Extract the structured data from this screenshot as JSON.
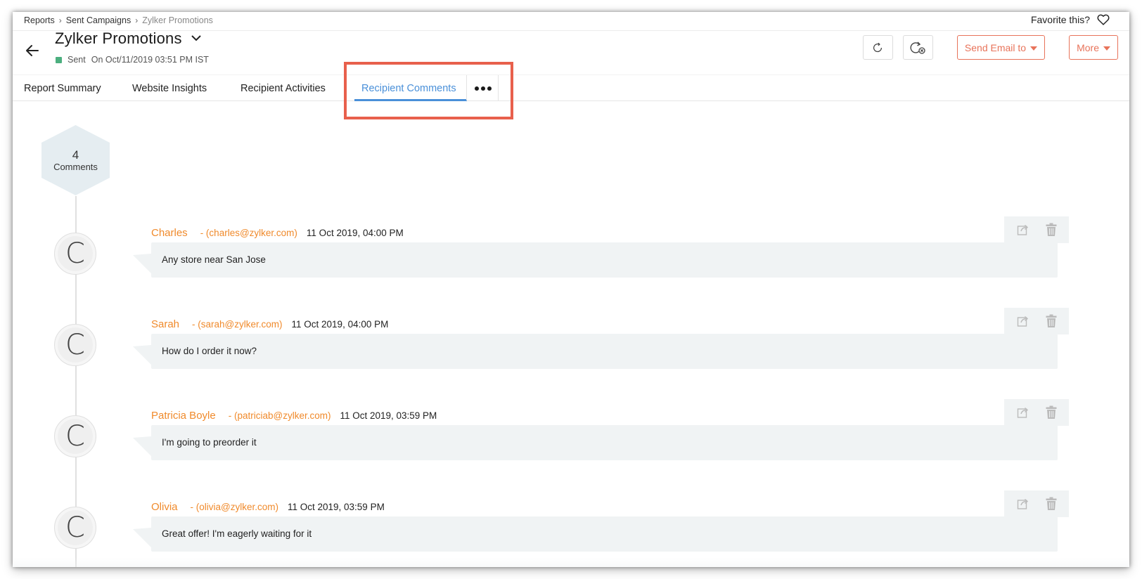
{
  "breadcrumb": [
    "Reports",
    "Sent Campaigns",
    "Zylker Promotions"
  ],
  "favorite_label": "Favorite this?",
  "campaign": {
    "title": "Zylker Promotions",
    "status": "Sent",
    "sent_on": "On Oct/11/2019 03:51 PM IST",
    "status_color": "#4caf7f"
  },
  "actions": {
    "send_email": "Send Email to",
    "more": "More"
  },
  "tabs": [
    {
      "label": "Report Summary",
      "active": false
    },
    {
      "label": "Website Insights",
      "active": false
    },
    {
      "label": "Recipient Activities",
      "active": false
    },
    {
      "label": "Recipient Comments",
      "active": true
    }
  ],
  "summary": {
    "count": "4",
    "label": "Comments"
  },
  "comments": [
    {
      "initial": "C",
      "name": "Charles",
      "email": "- (charles@zylker.com)",
      "time": "11 Oct 2019, 04:00 PM",
      "text": "Any store near San Jose"
    },
    {
      "initial": "C",
      "name": "Sarah",
      "email": "- (sarah@zylker.com)",
      "time": "11 Oct 2019, 04:00 PM",
      "text": "How do I order it now?"
    },
    {
      "initial": "C",
      "name": "Patricia Boyle",
      "email": "- (patriciab@zylker.com)",
      "time": "11 Oct 2019, 03:59 PM",
      "text": "I'm going to preorder it"
    },
    {
      "initial": "C",
      "name": "Olivia",
      "email": "- (olivia@zylker.com)",
      "time": "11 Oct 2019, 03:59 PM",
      "text": "Great offer! I'm eagerly waiting for it"
    }
  ],
  "colors": {
    "accent": "#4a90d9",
    "orange": "#f08a2b",
    "highlight": "#e8604c",
    "button": "#e8735a"
  },
  "icons": [
    "arrow-left-icon",
    "chevron-down-icon",
    "heart-icon",
    "refresh-icon",
    "refresh-cancel-icon",
    "share-icon",
    "trash-icon",
    "more-dots-icon"
  ]
}
